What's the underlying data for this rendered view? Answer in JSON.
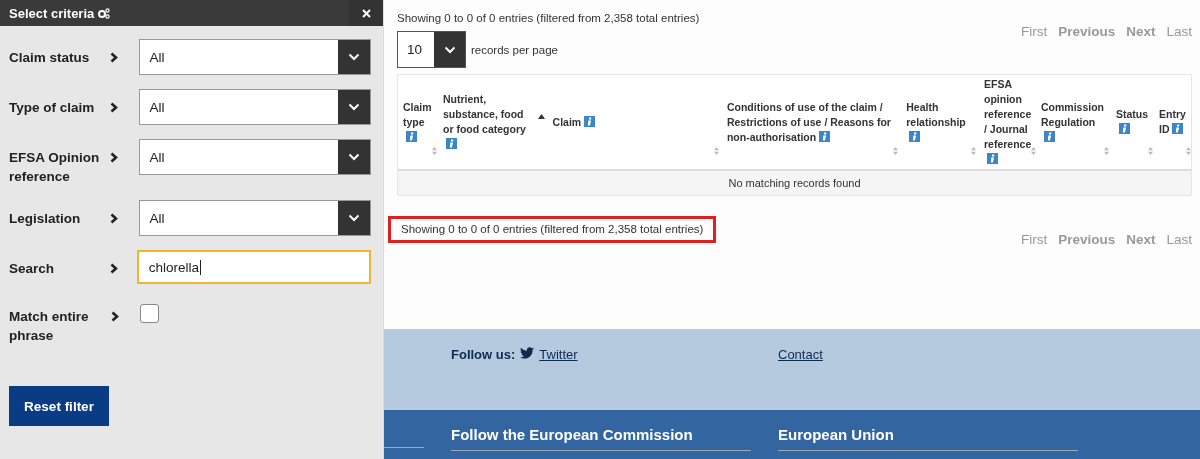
{
  "panel": {
    "title": "Select criteria",
    "filters": [
      {
        "kind": "select",
        "label": "Claim status",
        "value": "All"
      },
      {
        "kind": "select",
        "label": "Type of claim",
        "value": "All"
      },
      {
        "kind": "select",
        "label": "EFSA Opinion reference",
        "value": "All"
      },
      {
        "kind": "select",
        "label": "Legislation",
        "value": "All"
      },
      {
        "kind": "text",
        "label": "Search",
        "value": "chlorella",
        "focused": true
      },
      {
        "kind": "checkbox",
        "label": "Match entire phrase",
        "checked": false
      }
    ],
    "reset_button": "Reset filter"
  },
  "results": {
    "info_top": "Showing 0 to 0 of 0 entries (filtered from 2,358 total entries)",
    "pagination_top": [
      "First",
      "Previous",
      "Next",
      "Last"
    ],
    "page_size": {
      "value": "10",
      "label": "records per page"
    },
    "table": {
      "columns": [
        {
          "label": "Claim type",
          "info": true,
          "sorted": false
        },
        {
          "label": "Nutrient, substance, food or food category",
          "info": true,
          "sorted": true
        },
        {
          "label": "Claim",
          "info": true,
          "sorted": false
        },
        {
          "label": "Conditions of use of the claim / Restrictions of use / Reasons for non-authorisation",
          "info": true,
          "sorted": false
        },
        {
          "label": "Health relationship",
          "info": true,
          "sorted": false
        },
        {
          "label": "EFSA opinion reference / Journal reference",
          "info": true,
          "sorted": false
        },
        {
          "label": "Commission Regulation",
          "info": true,
          "sorted": false
        },
        {
          "label": "Status",
          "info": true,
          "sorted": false
        },
        {
          "label": "Entry ID",
          "info": true,
          "sorted": false
        }
      ],
      "empty_message": "No matching records found"
    },
    "info_bottom": {
      "text": "Showing 0 to 0 of 0 entries (filtered from 2,358 total entries)",
      "highlighted": true
    },
    "pagination_bottom": [
      "First",
      "Previous",
      "Next",
      "Last"
    ]
  },
  "footer": {
    "follow_label": "Follow us:",
    "twitter_link": "Twitter",
    "contact_link": "Contact",
    "headings": [
      "Follow the European Commission",
      "European Union"
    ]
  }
}
